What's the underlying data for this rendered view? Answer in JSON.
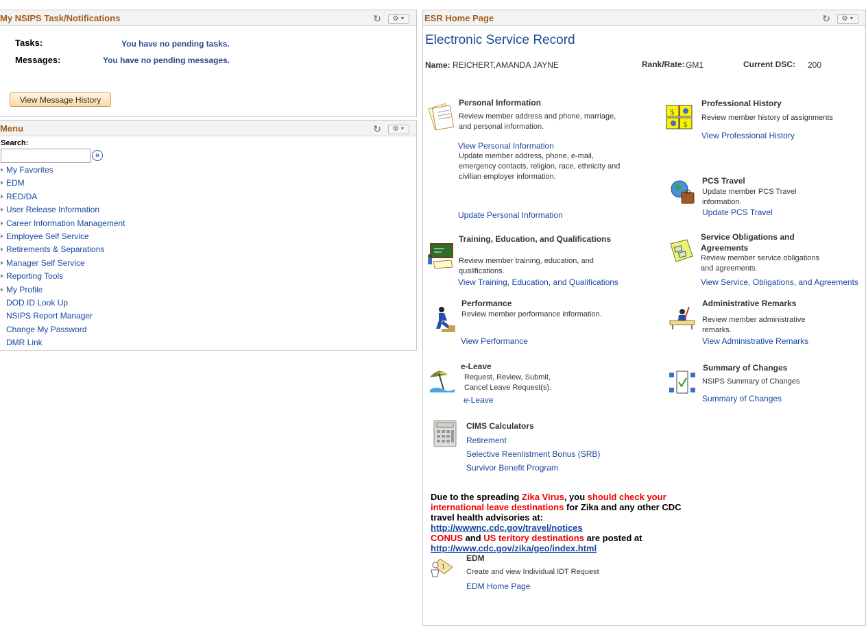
{
  "tasks_pagelet": {
    "title": "My NSIPS Task/Notifications",
    "tasks_label": "Tasks:",
    "tasks_value": "You have no pending tasks.",
    "messages_label": "Messages:",
    "messages_value": "You have no pending messages.",
    "history_button": "View Message History"
  },
  "menu_pagelet": {
    "title": "Menu",
    "search_label": "Search:",
    "search_value": "",
    "items": [
      {
        "label": "My Favorites",
        "expandable": true
      },
      {
        "label": "EDM",
        "expandable": true
      },
      {
        "label": "RED/DA",
        "expandable": true
      },
      {
        "label": "User Release Information",
        "expandable": true
      },
      {
        "label": "Career Information Management",
        "expandable": true
      },
      {
        "label": "Employee Self Service",
        "expandable": true
      },
      {
        "label": "Retirements & Separations",
        "expandable": true
      },
      {
        "label": "Manager Self Service",
        "expandable": true
      },
      {
        "label": "Reporting Tools",
        "expandable": true
      },
      {
        "label": "My Profile",
        "expandable": true
      },
      {
        "label": "DOD ID Look Up",
        "expandable": false
      },
      {
        "label": "NSIPS Report Manager",
        "expandable": false
      },
      {
        "label": "Change My Password",
        "expandable": false
      },
      {
        "label": "DMR Link",
        "expandable": false
      }
    ]
  },
  "esr": {
    "pagelet_title": "ESR Home Page",
    "heading": "Electronic Service Record",
    "name_label": "Name:",
    "name_value": "REICHERT,AMANDA JAYNE",
    "rank_label": "Rank/Rate:",
    "rank_value": "GM1",
    "dsc_label": "Current DSC:",
    "dsc_value": "200",
    "personal": {
      "title": "Personal Information",
      "desc": "Review member address and phone, marriage, and personal information.",
      "link1": "View Personal Information",
      "desc2": "Update member address, phone, e-mail, emergency contacts, religion, race, ethnicity and civilian employer information.",
      "link2": "Update Personal Information"
    },
    "professional": {
      "title": "Professional History",
      "desc": "Review member history of assignments",
      "link": "View Professional History"
    },
    "pcs": {
      "title": "PCS Travel",
      "desc": "Update member PCS Travel information.",
      "link": "Update PCS Travel"
    },
    "training": {
      "title": "Training, Education, and Qualifications",
      "desc": "Review member training, education, and qualifications.",
      "link": "View Training, Education, and Qualifications"
    },
    "service": {
      "title": "Service Obligations and Agreements",
      "desc": "Review member service obligations and agreements.",
      "link": "View Service, Obligations, and Agreements"
    },
    "performance": {
      "title": "Performance",
      "desc": "Review member performance information.",
      "link": "View Performance"
    },
    "admin": {
      "title": "Administrative Remarks",
      "desc": "Review member administrative remarks.",
      "link": "View Administrative Remarks"
    },
    "eleave": {
      "title": "e-Leave",
      "desc": "Request, Review, Submit, Cancel Leave Request(s).",
      "link": "e-Leave"
    },
    "summary": {
      "title": "Summary of Changes",
      "desc": "NSIPS Summary of Changes",
      "link": "Summary of Changes"
    },
    "cims": {
      "title": "CIMS Calculators",
      "link1": "Retirement",
      "link2": "Selective Reenlistment Bonus (SRB)",
      "link3": "Survivor Benefit Program"
    },
    "notice": {
      "t1": "Due to the spreading ",
      "r1": "Zika Virus",
      "t2": ", you ",
      "r2": "should check your international leave destinations",
      "t3": " for Zika and any other CDC travel health advisories at:",
      "url1": "http://wwwnc.cdc.gov/travel/notices",
      "r3": "CONUS",
      "t4": " and ",
      "r4": "US teritory destinations",
      "t5": " are posted at",
      "url2": "http://www.cdc.gov/zika/geo/index.html"
    },
    "edm": {
      "title": "EDM",
      "desc": "Create and view Individual IDT Request",
      "link": "EDM Home Page"
    }
  },
  "icons": {
    "refresh": "refresh-icon",
    "gear": "gear-icon",
    "search_go": "search-go-icon"
  },
  "colors": {
    "pagelet_title": "#a45b1a",
    "link": "#17479e",
    "alert": "#e00000"
  }
}
